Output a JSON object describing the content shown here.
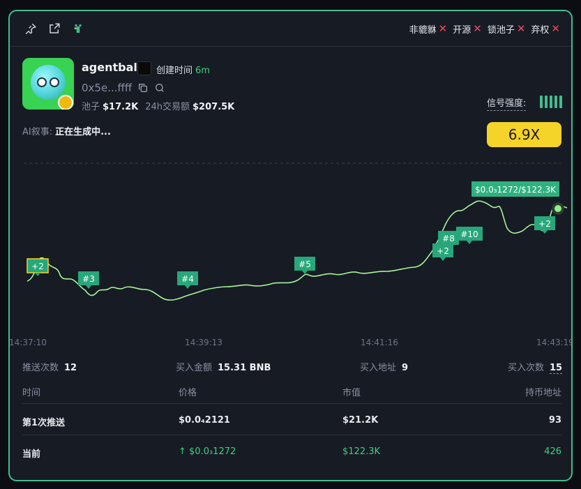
{
  "flags": [
    {
      "label": "非貔貅",
      "status": "✕"
    },
    {
      "label": "开源",
      "status": "✕"
    },
    {
      "label": "锁池子",
      "status": "✕"
    },
    {
      "label": "弃权",
      "status": "✕"
    }
  ],
  "token": {
    "name": "agentball",
    "created_label": "创建时间",
    "created_value": "6m",
    "address": "0x5e...ffff",
    "pool_label": "池子",
    "pool_value": "$17.2K",
    "volume_label": "24h交易额",
    "volume_value": "$207.5K"
  },
  "signal": {
    "label": "信号强度:",
    "multiplier": "6.9X",
    "bars": 5
  },
  "ai": {
    "label": "AI叙事:",
    "value": "正在生成中..."
  },
  "chart_data": {
    "type": "line",
    "x_ticks": [
      "14:37:10",
      "14:39:13",
      "14:41:16",
      "14:43:19"
    ],
    "current_label": "$0.0₃1272/$122.3K",
    "markers": [
      "+2",
      "#3",
      "#4",
      "#5",
      "+2",
      "#8",
      "#10",
      "+2"
    ],
    "color": "#a6f59a"
  },
  "summary": {
    "push_label": "推送次数",
    "push_value": "12",
    "buy_amount_label": "买入金额",
    "buy_amount_value": "15.31 BNB",
    "buy_addr_label": "买入地址",
    "buy_addr_value": "9",
    "buy_count_label": "买入次数",
    "buy_count_value": "15"
  },
  "table": {
    "headers": [
      "时间",
      "价格",
      "市值",
      "持币地址"
    ],
    "rows": [
      {
        "time": "第1次推送",
        "price": "$0.0₄2121",
        "mcap": "$21.2K",
        "holders": "93"
      },
      {
        "time": "当前",
        "price": "↑ $0.0₃1272",
        "mcap": "$122.3K",
        "holders": "426"
      }
    ]
  },
  "colors": {
    "accent": "#3fbf8f",
    "up": "#3fd07e",
    "warn": "#f0475a",
    "multiplier_bg": "#f5d328"
  }
}
